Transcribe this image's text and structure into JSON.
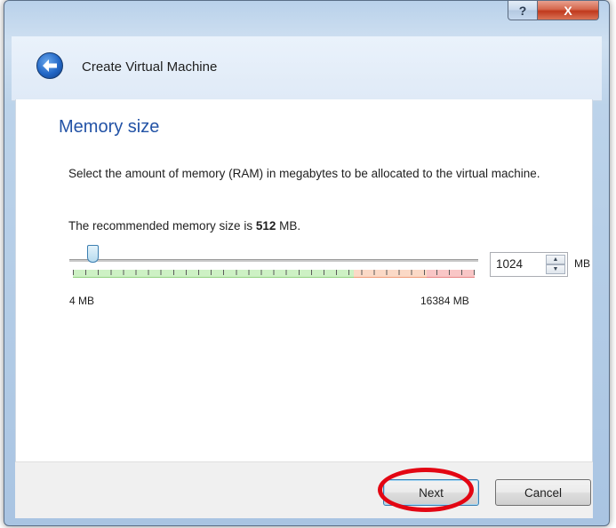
{
  "window": {
    "help_glyph": "?",
    "close_glyph": "X"
  },
  "header": {
    "title": "Create Virtual Machine",
    "back_icon": "back-arrow-icon"
  },
  "page": {
    "title": "Memory size",
    "description": "Select the amount of memory (RAM) in megabytes to be allocated to the virtual machine.",
    "recommend_prefix": "The recommended memory size is ",
    "recommend_value": "512",
    "recommend_suffix": " MB."
  },
  "memory": {
    "min_label": "4 MB",
    "max_label": "16384 MB",
    "value": "1024",
    "unit": "MB",
    "slider_fraction": 0.0622
  },
  "footer": {
    "next_label": "Next",
    "cancel_label": "Cancel"
  },
  "colors": {
    "accent": "#2353a6",
    "highlight": "#e30613",
    "scale_safe": "#cdf1c4",
    "scale_warn": "#fbd9c6",
    "scale_danger": "#f9c6c6"
  }
}
